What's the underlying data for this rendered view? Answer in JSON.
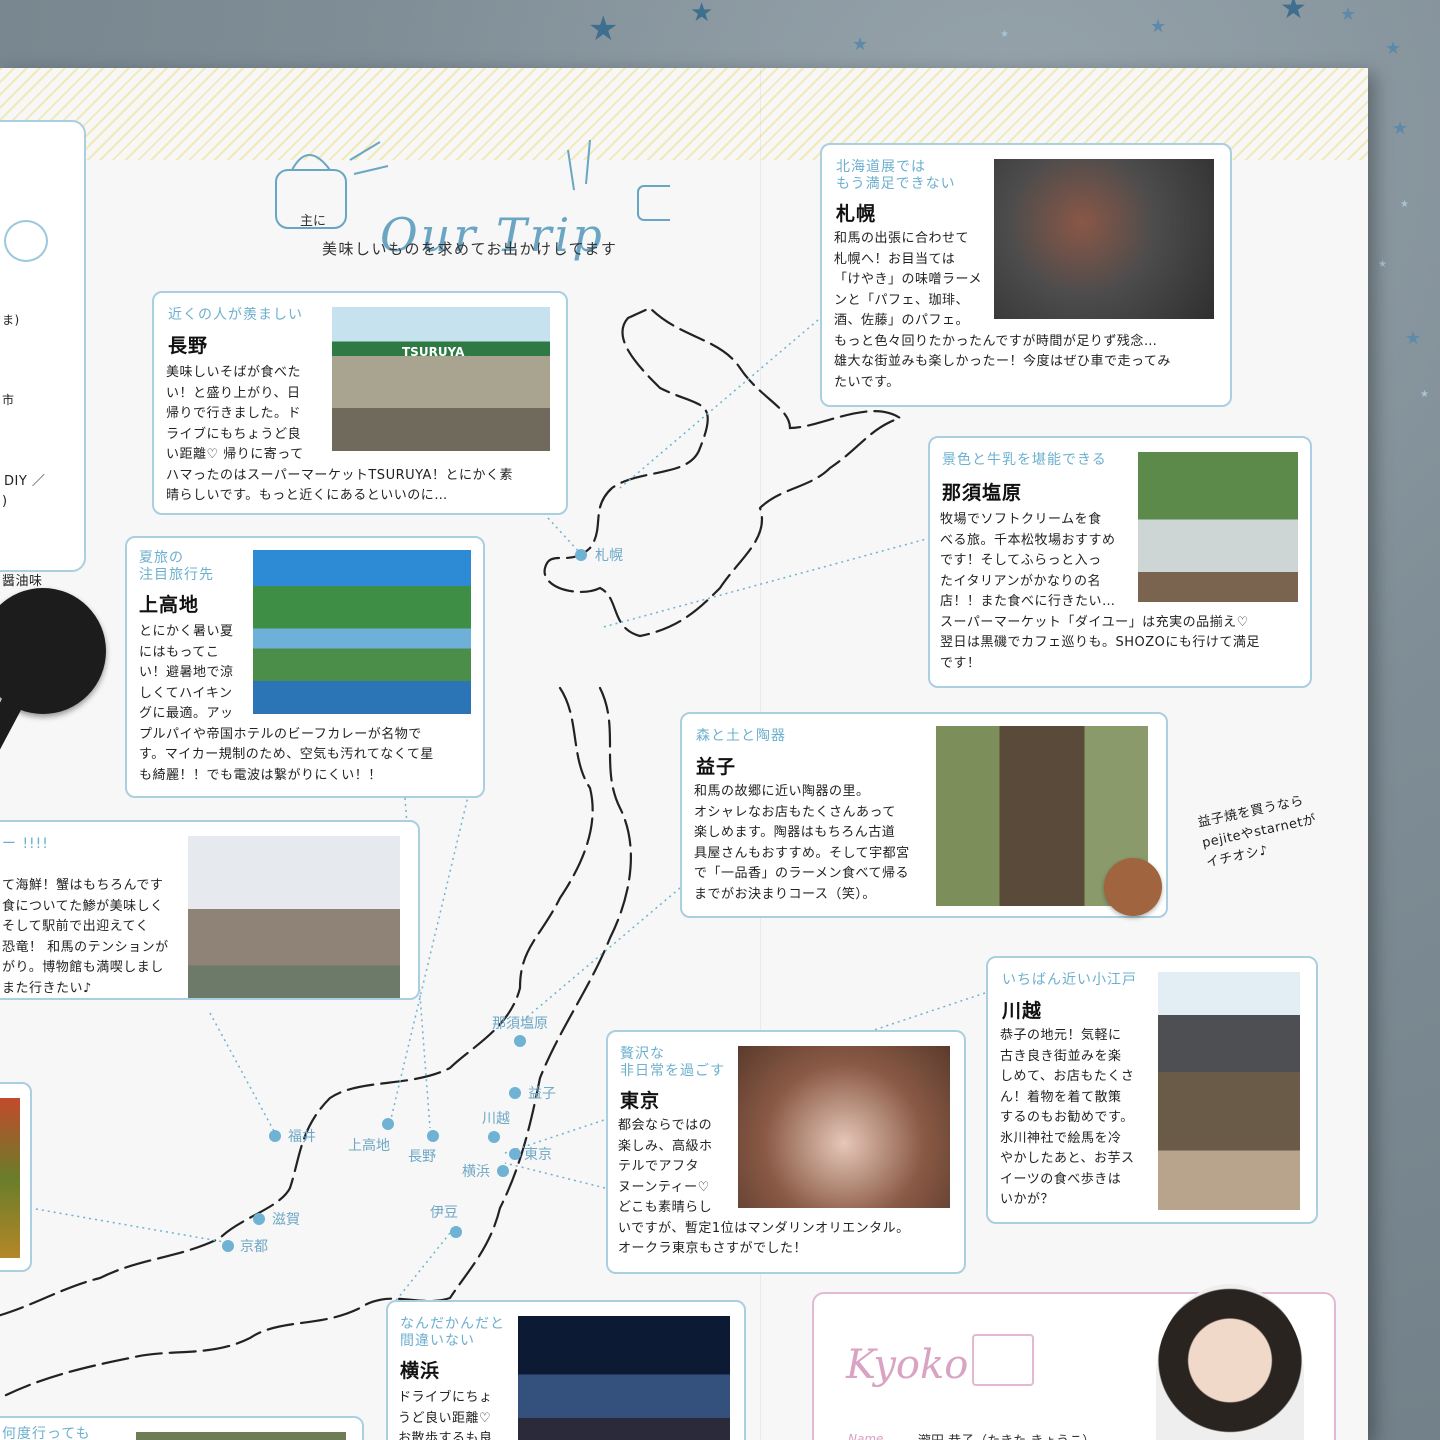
{
  "header": {
    "title": "Our Trip",
    "small_note": "主に",
    "subtitle": "美味しいものを求めてお出かけしてます"
  },
  "cards": {
    "nagano": {
      "sub": "近くの人が羨ましい",
      "place": "長野",
      "body": "美味しいそばが食べた\nい！と盛り上がり、日\n帰りで行きました。ド\nライブにもちょうど良\nい距離♡ 帰りに寄って\nハマったのはスーパーマーケットTSURUYA！とにかく素\n晴らしいです。もっと近くにあるといいのに…",
      "photo_sign": "TSURUYA"
    },
    "kamikochi": {
      "sub": "夏旅の\n注目旅行先",
      "place": "上高地",
      "body": "とにかく暑い夏\nにはもってこ\nい！避暑地で涼\nしくてハイキン\nグに最適。アッ\nプルパイや帝国ホテルのビーフカレーが名物で\nす。マイカー規制のため、空気も汚れてなくて星\nも綺麗！！でも電波は繋がりにくい！！"
    },
    "fukui": {
      "sub": "ー !!!!",
      "body": "て海鮮！蟹はもちろんです\n食についてた鯵が美味しく\nそして駅前で出迎えてく\n恐竜！ 和馬のテンションが\nがり。博物館も満喫しまし\nまた行きたい♪"
    },
    "sapporo": {
      "sub": "北海道展では\nもう満足できない",
      "place": "札幌",
      "body": "和馬の出張に合わせて\n札幌へ！お目当ては\n「けやき」の味噌ラーメ\nンと「パフェ、珈琲、\n酒、佐藤」のパフェ。\nもっと色々回りたかったんですが時間が足りず残念…\n雄大な街並みも楽しかったー！今度はぜひ車で走ってみ\nたいです。"
    },
    "nasu": {
      "sub": "景色と牛乳を堪能できる",
      "place": "那須塩原",
      "body": "牧場でソフトクリームを食\nべる旅。千本松牧場おすすめ\nです！そしてふらっと入っ\nたイタリアンがかなりの名\n店！！また食べに行きたい…\nスーパーマーケット「ダイユー」は充実の品揃え♡\n翌日は黒磯でカフェ巡りも。SHOZOにも行けて満足\nです！"
    },
    "mashiko": {
      "sub": "森と土と陶器",
      "place": "益子",
      "body": "和馬の故郷に近い陶器の里。\nオシャレなお店もたくさんあって\n楽しめます。陶器はもちろん古道\n具屋さんもおすすめ。そして宇都宮\nで「一品香」のラーメン食べて帰る\nまでがお決まりコース（笑）。"
    },
    "mashiko_note": "益子焼を買うなら\npejiteやstarnetが\nイチオシ♪",
    "kawagoe": {
      "sub": "いちばん近い小江戸",
      "place": "川越",
      "body": "恭子の地元！気軽に\n古き良き街並みを楽\nしめて、お店もたくさ\nん！着物を着て散策\nするのもお勧めです。\n氷川神社で絵馬を冷\nやかしたあと、お芋ス\nイーツの食べ歩きは\nいかが？"
    },
    "tokyo": {
      "sub": "贅沢な\n非日常を過ごす",
      "place": "東京",
      "body": "都会ならではの\n楽しみ、高級ホ\nテルでアフタ\nヌーンティー♡\nどこも素晴らし\nいですが、暫定1位はマンダリンオリエンタル。\nオークラ東京もさすがでした！"
    },
    "yokohama": {
      "sub": "なんだかんだと\n間違いない",
      "place": "横浜",
      "body": "ドライブにちょ\nうど良い距離♡\nお散歩するも良"
    },
    "bottom_left": {
      "sub": "何度行っても"
    }
  },
  "pins": {
    "sapporo": "札幌",
    "nasu": "那須塩原",
    "mashiko": "益子",
    "kawagoe": "川越",
    "tokyo": "東京",
    "yokohama": "横浜",
    "izu": "伊豆",
    "fukui": "福井",
    "kamikochi": "上高地",
    "nagano": "長野",
    "shiga": "滋賀",
    "kyoto": "京都"
  },
  "left_panel": {
    "line1": "ま)",
    "line2": "市",
    "line3": "DIY ／",
    "line4": ")",
    "line5": "醤油味"
  },
  "profile": {
    "name_script": "Kyoko",
    "name_label": "Name",
    "name_value": "瀧田 恭子（たきた きょうこ）"
  },
  "colors": {
    "accent": "#6cb0cf",
    "card_border": "#a9cfe0",
    "pink": "#d9a3c3"
  }
}
